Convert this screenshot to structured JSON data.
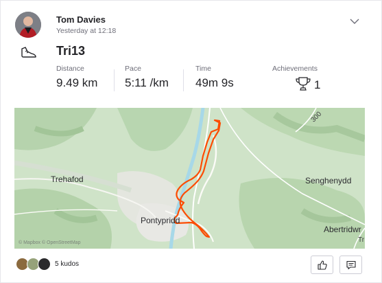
{
  "athlete": {
    "name": "Tom Davies",
    "timestamp": "Yesterday at 12:18"
  },
  "activity": {
    "title": "Tri13",
    "sport_icon": "running-shoe-icon"
  },
  "stats": [
    {
      "label": "Distance",
      "value": "9.49 km"
    },
    {
      "label": "Pace",
      "value": "5:11 /km"
    },
    {
      "label": "Time",
      "value": "49m 9s"
    }
  ],
  "achievements": {
    "label": "Achievements",
    "count": "1",
    "icon": "trophy-icon"
  },
  "map": {
    "places": {
      "trehafod": "Trehafod",
      "pontypridd": "Pontypridd",
      "senghenydd": "Senghenydd",
      "abertridwr": "Abertridwr"
    },
    "road_number": "300",
    "edge_label": "Tr",
    "copyright": "© Mapbox © OpenStreetMap",
    "route_color": "#fc4c02"
  },
  "footer": {
    "kudos_text": "5 kudos",
    "kudos_icon": "thumbs-up-icon",
    "comment_icon": "comment-icon"
  },
  "colors": {
    "accent": "#fc4c02",
    "text": "#242428",
    "muted": "#6d6d78"
  }
}
